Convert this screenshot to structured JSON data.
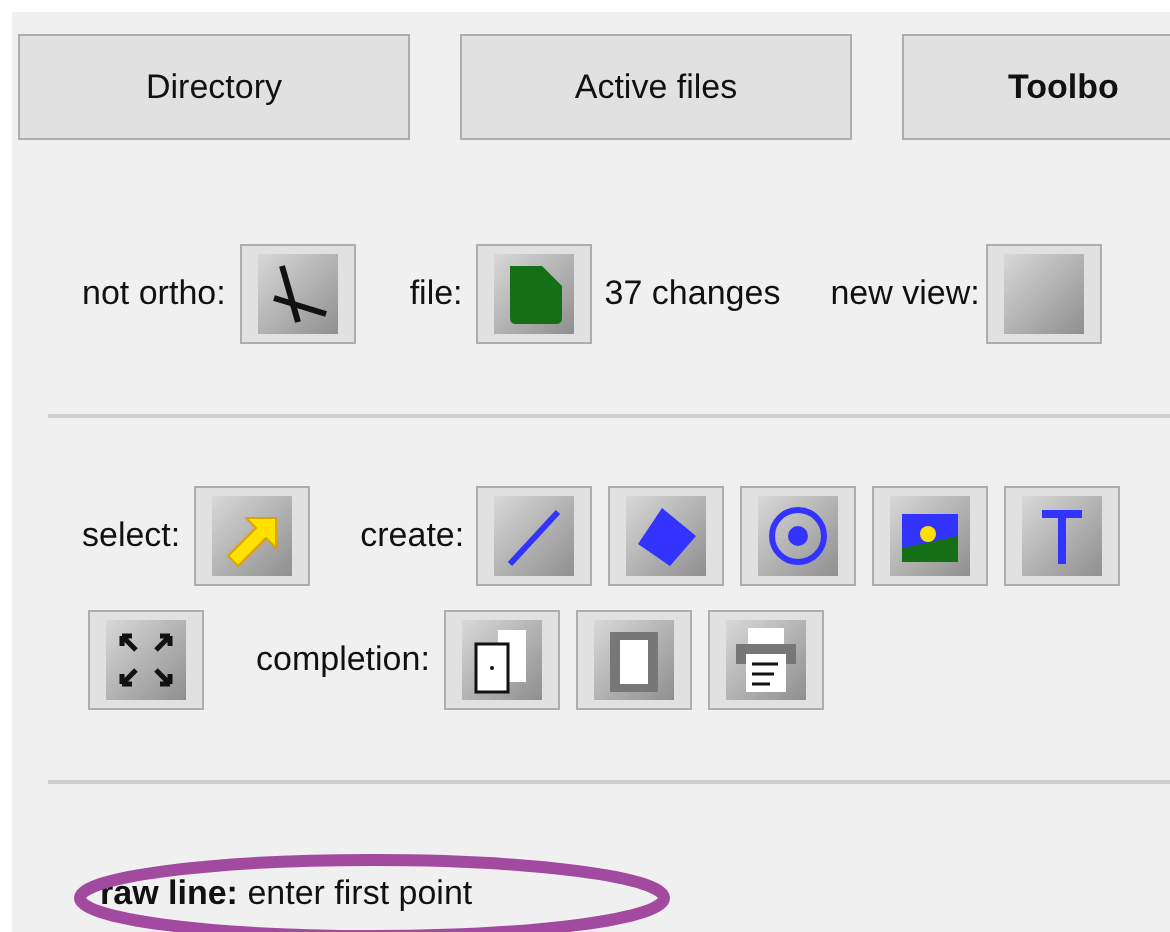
{
  "tabs": [
    {
      "label": "Directory",
      "selected": false
    },
    {
      "label": "Active files",
      "selected": false
    },
    {
      "label": "Toolbo",
      "selected": true
    }
  ],
  "view_row": {
    "ortho_label": "not ortho:",
    "file_label": "file:",
    "changes": "37 changes",
    "new_view_label": "new view:"
  },
  "tools_row": {
    "select_label": "select:",
    "create_label": "create:"
  },
  "completion_row": {
    "completion_label": "completion:"
  },
  "status": "**raw line:** enter first point"
}
